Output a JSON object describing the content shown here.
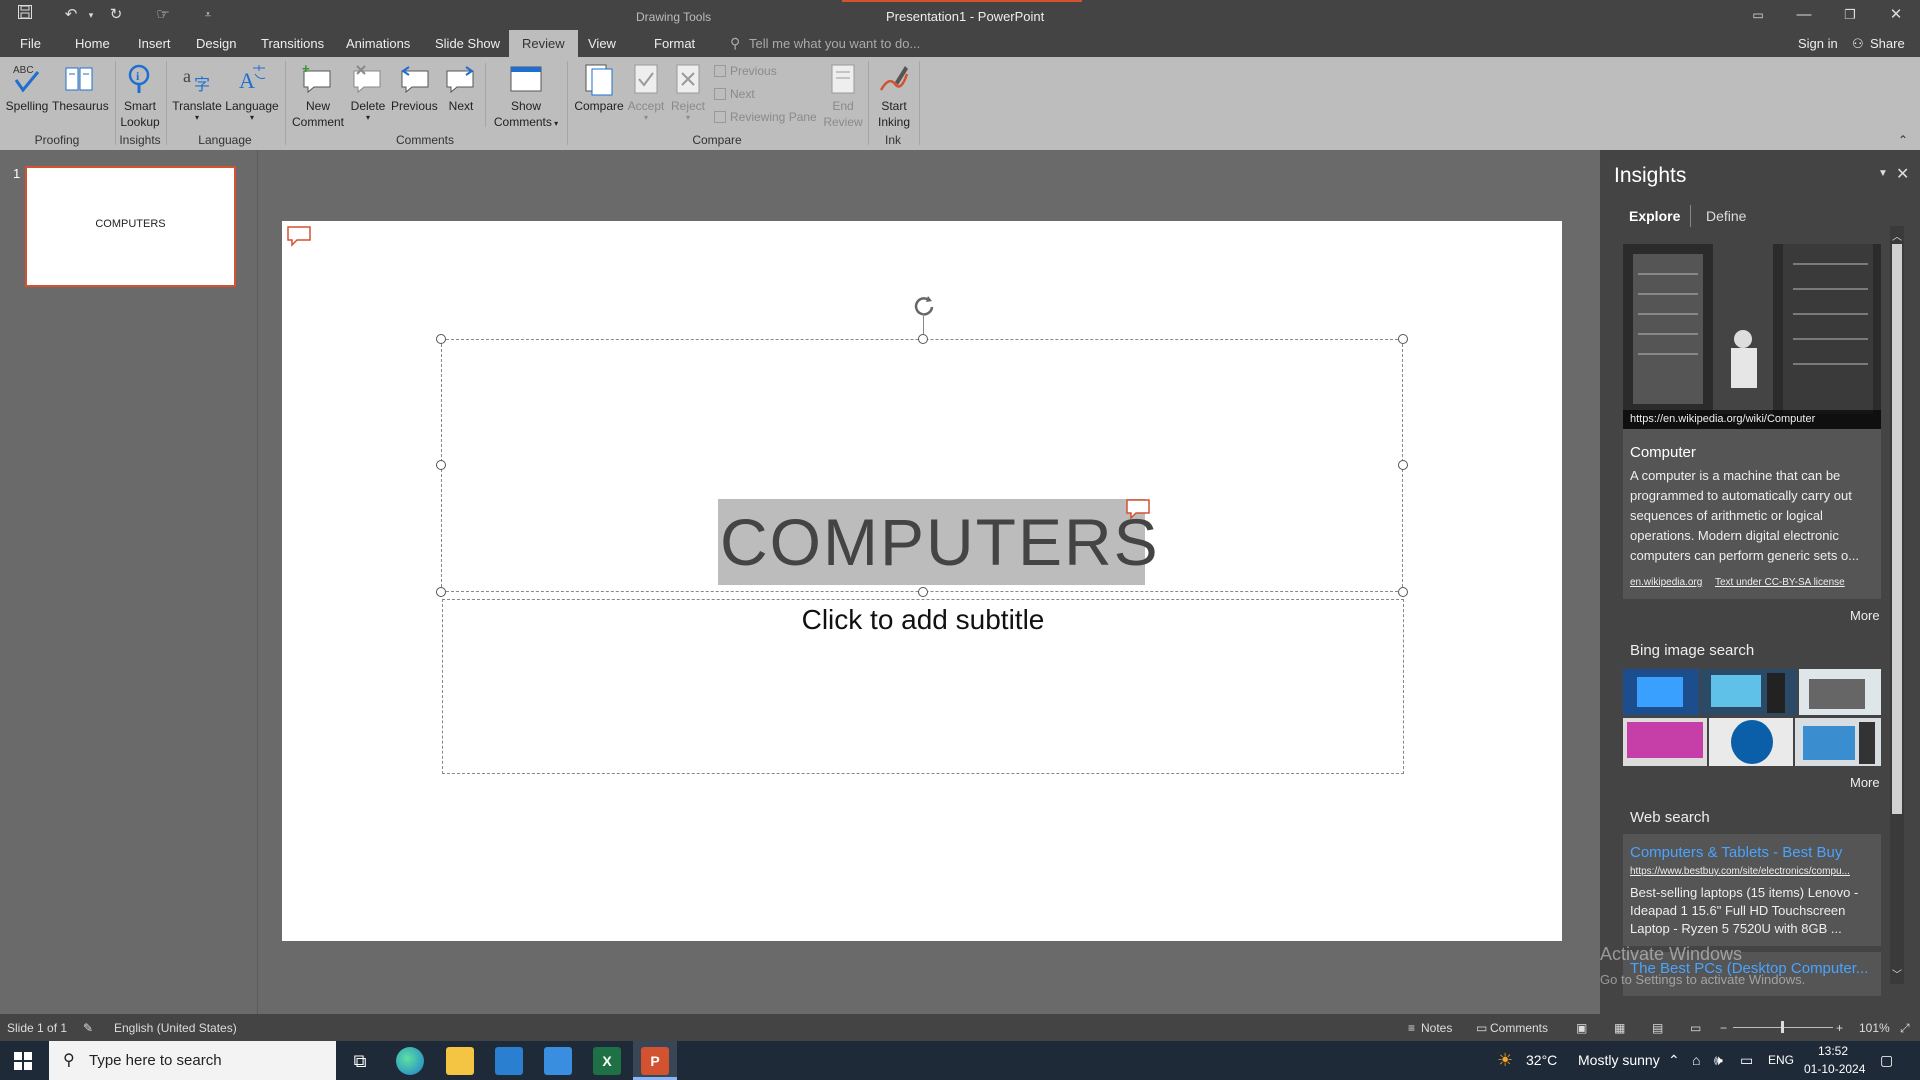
{
  "titlebar": {
    "drawing_tools": "Drawing Tools",
    "window_title": "Presentation1 - PowerPoint",
    "qat": [
      "save-icon",
      "undo-icon",
      "redo-icon",
      "touch-mode-icon",
      "customize-qat-icon"
    ]
  },
  "tabs": {
    "file": "File",
    "home": "Home",
    "insert": "Insert",
    "design": "Design",
    "transitions": "Transitions",
    "animations": "Animations",
    "slideshow": "Slide Show",
    "review": "Review",
    "view": "View",
    "format": "Format"
  },
  "tell_me": "Tell me what you want to do...",
  "sign_in": "Sign in",
  "share": "Share",
  "ribbon": {
    "spelling": "Spelling",
    "thesaurus": "Thesaurus",
    "smart": "Smart",
    "lookup": "Lookup",
    "translate": "Translate",
    "language": "Language",
    "new": "New",
    "comment": "Comment",
    "delete": "Delete",
    "previous": "Previous",
    "next": "Next",
    "show": "Show",
    "comments": "Comments",
    "compare": "Compare",
    "accept": "Accept",
    "reject": "Reject",
    "prev_small": "Previous",
    "next_small": "Next",
    "reviewing_pane": "Reviewing Pane",
    "end": "End",
    "review": "Review",
    "start": "Start",
    "inking": "Inking",
    "groups": {
      "proofing": "Proofing",
      "insights": "Insights",
      "language": "Language",
      "comments": "Comments",
      "compare": "Compare",
      "ink": "Ink"
    }
  },
  "thumbnails": {
    "slide_number": "1",
    "thumb_text": "COMPUTERS"
  },
  "slide": {
    "title": "COMPUTERS",
    "subtitle": "Click to add subtitle"
  },
  "insights": {
    "title": "Insights",
    "tab_explore": "Explore",
    "tab_define": "Define",
    "image_url": "https://en.wikipedia.org/wiki/Computer",
    "card_title": "Computer",
    "card_desc": "A computer is a machine that can be programmed to automatically carry out sequences of arithmetic or logical operations. Modern digital electronic computers can perform generic sets o...",
    "source": "en.wikipedia.org",
    "license": "Text under CC-BY-SA license",
    "more1": "More",
    "bing_heading": "Bing image search",
    "more2": "More",
    "web_heading": "Web search",
    "web_title": "Computers & Tablets - Best Buy",
    "web_url": "https://www.bestbuy.com/site/electronics/compu...",
    "web_desc": "Best-selling laptops (15 items) Lenovo - Ideapad 1 15.6\" Full HD Touchscreen Laptop - Ryzen 5 7520U with 8GB ...",
    "web2_title": "The Best PCs (Desktop Computer..."
  },
  "watermark": {
    "line1": "Activate Windows",
    "line2": "Go to Settings to activate Windows."
  },
  "statusbar": {
    "slide": "Slide 1 of 1",
    "language": "English (United States)",
    "notes": "Notes",
    "comments": "Comments",
    "zoom": "101%"
  },
  "taskbar": {
    "search_placeholder": "Type here to search",
    "temperature": "32°C",
    "weather": "Mostly sunny",
    "lang": "ENG",
    "time": "13:52",
    "date": "01-10-2024"
  },
  "colors": {
    "accent": "#d35230",
    "link": "#4aa3ff",
    "ribbon_bg": "#bdbdbd",
    "chrome_bg": "#444444"
  }
}
